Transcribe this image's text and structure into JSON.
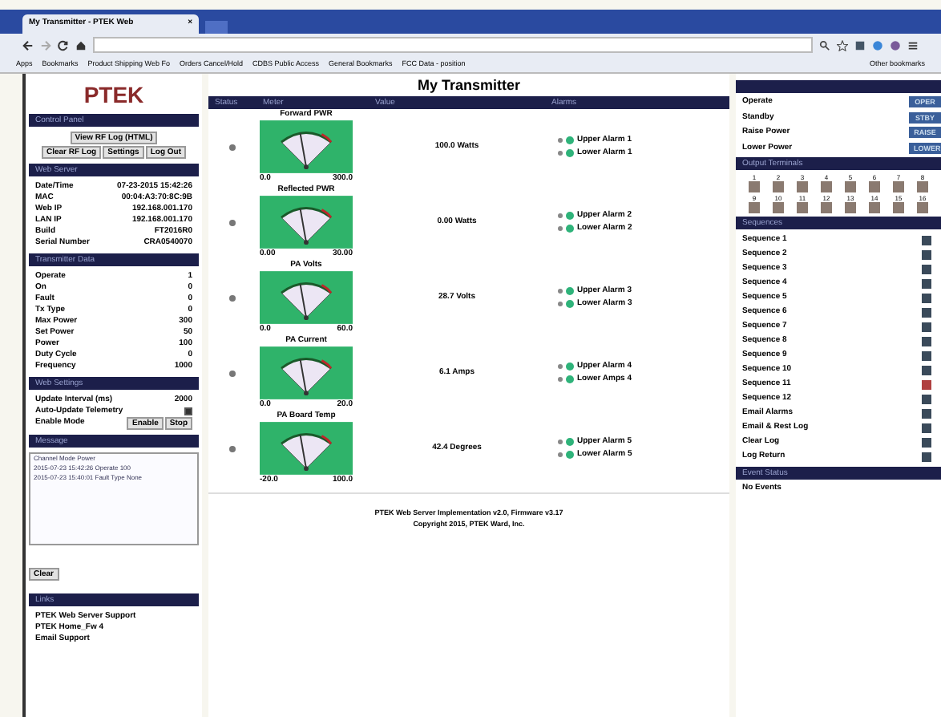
{
  "browser": {
    "tab_title": "My Transmitter - PTEK Web",
    "tab_close": "×",
    "bookmarks": [
      "Apps",
      "Bookmarks",
      "Product Shipping Web Fo",
      "Orders Cancel/Hold",
      "CDBS Public Access",
      "General Bookmarks",
      "FCC Data - position"
    ],
    "other_bookmarks": "Other bookmarks"
  },
  "sidebar": {
    "logo": "PTEK",
    "control": {
      "title": "Control Panel",
      "buttons": [
        "View RF Log (HTML)",
        "Clear RF Log",
        "Settings",
        "Log Out"
      ]
    },
    "status": {
      "title": "Web Server",
      "rows": [
        {
          "label": "Date/Time",
          "value": "07-23-2015 15:42:26"
        },
        {
          "label": "MAC",
          "value": "00:04:A3:70:8C:9B"
        },
        {
          "label": "Web IP",
          "value": "192.168.001.170"
        },
        {
          "label": "LAN IP",
          "value": "192.168.001.170"
        },
        {
          "label": "Build",
          "value": "FT2016R0"
        },
        {
          "label": "Serial Number",
          "value": "CRA0540070"
        }
      ]
    },
    "transmitter": {
      "title": "Transmitter Data",
      "rows": [
        {
          "label": "Operate",
          "value": "1"
        },
        {
          "label": "On",
          "value": "0"
        },
        {
          "label": "Fault",
          "value": "0"
        },
        {
          "label": "Tx Type",
          "value": "0"
        },
        {
          "label": "Max Power",
          "value": "300"
        },
        {
          "label": "Set Power",
          "value": "50"
        },
        {
          "label": "Power",
          "value": "100"
        },
        {
          "label": "Duty Cycle",
          "value": "0"
        },
        {
          "label": "Frequency",
          "value": "1000"
        }
      ]
    },
    "settings": {
      "title": "Web Settings",
      "rows": [
        {
          "label": "Update Interval (ms)",
          "value": "2000"
        },
        {
          "label": "Auto-Update Telemetry",
          "checked": true
        }
      ],
      "mode_label": "Enable Mode",
      "mode_buttons": [
        "Enable",
        "Stop"
      ]
    },
    "log": {
      "title": "Message",
      "lines": [
        "Channel  Mode  Power",
        "2015-07-23 15:42:26  Operate  100",
        "2015-07-23 15:40:01  Fault  Type  None"
      ],
      "clear": "Clear"
    },
    "links": {
      "title": "Links",
      "items": [
        "PTEK Web Server Support",
        "PTEK Home_Fw 4",
        "Email Support"
      ]
    }
  },
  "main": {
    "title": "My Transmitter",
    "columns": [
      "Status",
      "Meter",
      "Value",
      "Alarms"
    ],
    "meters": [
      {
        "name": "Forward PWR",
        "min": "0.0",
        "max": "300.0",
        "value": "100.0 Watts",
        "alarms": [
          {
            "label": "Upper Alarm 1",
            "on": false
          },
          {
            "label": "Lower Alarm 1",
            "on": false
          }
        ]
      },
      {
        "name": "Reflected PWR",
        "min": "0.00",
        "max": "30.00",
        "value": "0.00 Watts",
        "alarms": [
          {
            "label": "Upper Alarm 2",
            "on": false
          },
          {
            "label": "Lower Alarm 2",
            "on": false
          }
        ]
      },
      {
        "name": "PA Volts",
        "min": "0.0",
        "max": "60.0",
        "value": "28.7 Volts",
        "alarms": [
          {
            "label": "Upper Alarm 3",
            "on": false
          },
          {
            "label": "Lower Alarm 3",
            "on": false
          }
        ]
      },
      {
        "name": "PA Current",
        "min": "0.0",
        "max": "20.0",
        "value": "6.1 Amps",
        "alarms": [
          {
            "label": "Upper Alarm 4",
            "on": false
          },
          {
            "label": "Lower Amps 4",
            "on": false
          }
        ]
      },
      {
        "name": "PA Board Temp",
        "min": "-20.0",
        "max": "100.0",
        "value": "42.4 Degrees",
        "alarms": [
          {
            "label": "Upper Alarm 5",
            "on": false
          },
          {
            "label": "Lower Alarm 5",
            "on": false
          }
        ]
      }
    ],
    "footer": [
      "PTEK Web Server Implementation v2.0, Firmware v3.17",
      "Copyright 2015, PTEK Ward, Inc."
    ]
  },
  "right": {
    "commands": [
      {
        "label": "Operate",
        "button": "OPER"
      },
      {
        "label": "Standby",
        "button": "STBY"
      },
      {
        "label": "Raise Power",
        "button": "RAISE"
      },
      {
        "label": "Lower Power",
        "button": "LOWER"
      }
    ],
    "outputs": {
      "title": "Output Terminals",
      "items": [
        {
          "label": "1",
          "on": false
        },
        {
          "label": "2",
          "on": false
        },
        {
          "label": "3",
          "on": false
        },
        {
          "label": "4",
          "on": false
        },
        {
          "label": "5",
          "on": false
        },
        {
          "label": "6",
          "on": false
        },
        {
          "label": "7",
          "on": false
        },
        {
          "label": "8",
          "on": false
        },
        {
          "label": "9",
          "on": false
        },
        {
          "label": "10",
          "on": false
        },
        {
          "label": "11",
          "on": false
        },
        {
          "label": "12",
          "on": false
        },
        {
          "label": "13",
          "on": false
        },
        {
          "label": "14",
          "on": false
        },
        {
          "label": "15",
          "on": false
        },
        {
          "label": "16",
          "on": false
        }
      ]
    },
    "sequences": {
      "title": "Sequences",
      "items": [
        {
          "label": "Sequence 1",
          "checked": false
        },
        {
          "label": "Sequence 2",
          "checked": false
        },
        {
          "label": "Sequence 3",
          "checked": false
        },
        {
          "label": "Sequence 4",
          "checked": false
        },
        {
          "label": "Sequence 5",
          "checked": false
        },
        {
          "label": "Sequence 6",
          "checked": false
        },
        {
          "label": "Sequence 7",
          "checked": false
        },
        {
          "label": "Sequence 8",
          "checked": false
        },
        {
          "label": "Sequence 9",
          "checked": false
        },
        {
          "label": "Sequence 10",
          "checked": false
        },
        {
          "label": "Sequence 11",
          "checked": true
        },
        {
          "label": "Sequence 12",
          "checked": false
        },
        {
          "label": "Email Alarms",
          "checked": false
        },
        {
          "label": "Email & Rest Log",
          "checked": false
        },
        {
          "label": "Clear Log",
          "checked": false
        },
        {
          "label": "Log Return",
          "checked": false
        }
      ]
    },
    "events": {
      "title": "Event Status",
      "text": "No Events"
    }
  }
}
